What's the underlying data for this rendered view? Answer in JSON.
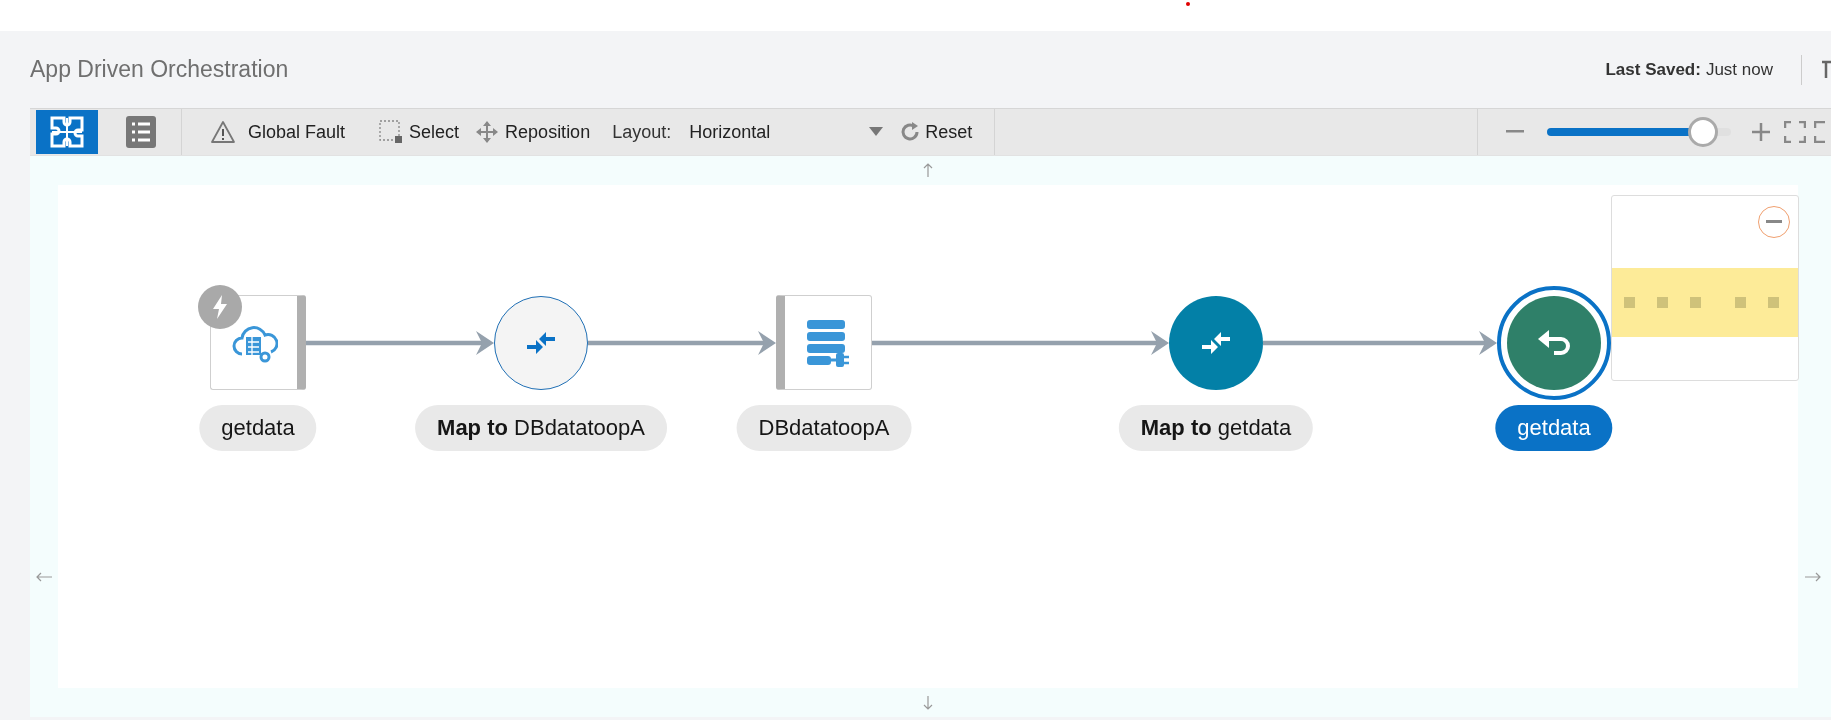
{
  "header": {
    "title": "App Driven Orchestration",
    "last_saved_label": "Last Saved:",
    "last_saved_value": "Just now"
  },
  "toolbar": {
    "views": [
      {
        "kind": "diagram",
        "selected": true
      },
      {
        "kind": "list",
        "selected": false
      }
    ],
    "actions": [
      {
        "kind": "fault",
        "label": "Global Fault"
      },
      {
        "kind": "select",
        "label": "Select"
      },
      {
        "kind": "reposition",
        "label": "Reposition"
      }
    ],
    "layout": {
      "label": "Layout:",
      "value": "Horizontal"
    },
    "reset": {
      "label": "Reset"
    },
    "zoom": {
      "level": 0.85
    }
  },
  "flow": {
    "nodes": [
      {
        "kind": "trigger",
        "label": "getdata",
        "selected": false
      },
      {
        "kind": "map",
        "label": "**Map to** DBdatatoopA",
        "selected": false,
        "hovered": true
      },
      {
        "kind": "invoke",
        "label": "DBdatatoopA",
        "selected": false
      },
      {
        "kind": "map",
        "label": "**Map to** getdata",
        "selected": false,
        "hovered": false
      },
      {
        "kind": "return",
        "label": "getdata",
        "selected": true
      }
    ]
  }
}
